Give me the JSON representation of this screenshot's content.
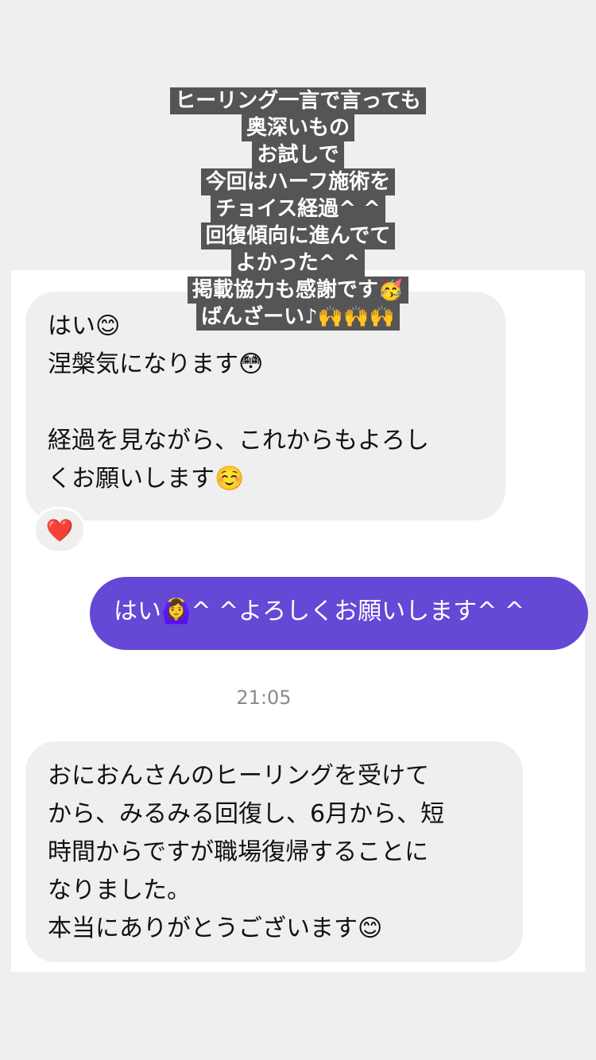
{
  "caption": {
    "lines": [
      "ヒーリング一言で言っても",
      "奥深いもの",
      "お試しで",
      "今回はハーフ施術を",
      "チョイス経過^ ^",
      "回復傾向に進んでて",
      "よかった^ ^",
      "掲載協力も感謝です🥳",
      "ばんざーい♪🙌🙌🙌"
    ]
  },
  "chat": {
    "messages": [
      {
        "direction": "incoming",
        "text": "はい😊\n涅槃気になります😳\n\n経過を見ながら、これからもよろし\nくお願いします☺️",
        "reaction": "❤️"
      },
      {
        "direction": "outgoing",
        "text": "はい🙆‍♀️^ ^よろしくお願いします^ ^"
      },
      {
        "direction": "incoming",
        "text": "おにおんさんのヒーリングを受けて\nから、みるみる回復し、6月から、短\n時間からですが職場復帰することに\nなりました。\n本当にありがとうございます😊"
      }
    ],
    "timestamp": "21:05"
  },
  "colors": {
    "page_background": "#efefef",
    "chat_background": "#ffffff",
    "incoming_bubble": "#efefef",
    "outgoing_bubble": "#6548d6",
    "caption_background": "#555555",
    "timestamp_text": "#8a8a8a"
  }
}
